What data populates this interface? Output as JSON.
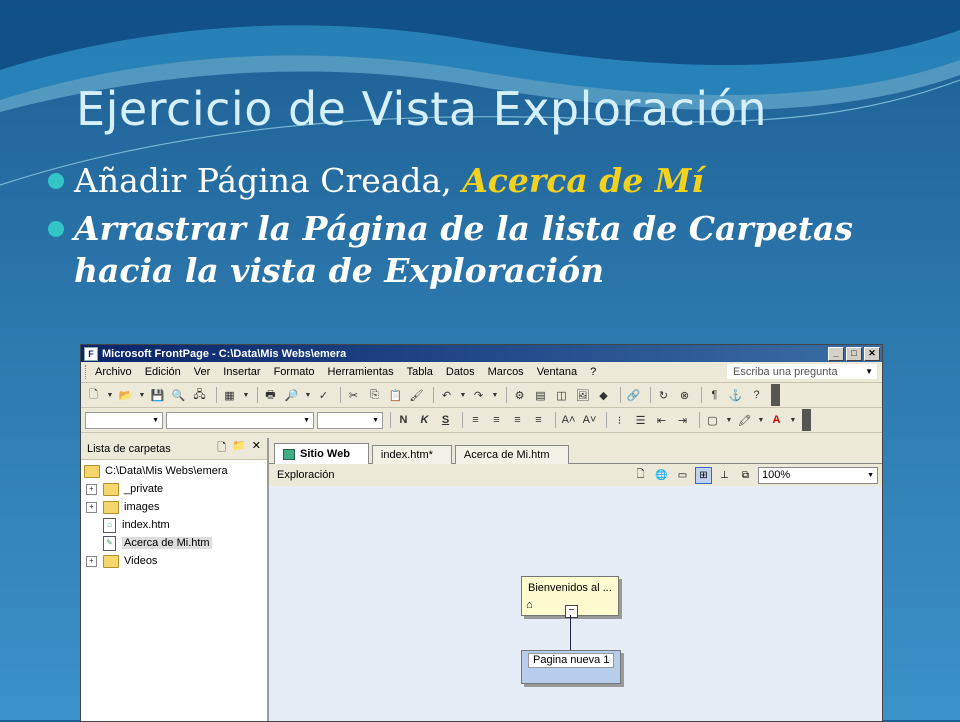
{
  "slide": {
    "title": "Ejercicio de Vista Exploración",
    "bullet1_prefix": "Añadir Página Creada, ",
    "bullet1_highlight": "Acerca de Mí",
    "bullet2": "Arrastrar la Página de la lista de Carpetas hacia la vista de Exploración",
    "colors": {
      "title": "#d6f0fb",
      "highlight": "#f2d21e",
      "bullet": "#33c6c6"
    }
  },
  "window": {
    "title": "Microsoft FrontPage - C:\\Data\\Mis Webs\\emera",
    "menu": [
      "Archivo",
      "Edición",
      "Ver",
      "Insertar",
      "Formato",
      "Herramientas",
      "Tabla",
      "Datos",
      "Marcos",
      "Ventana",
      "?"
    ],
    "ask_placeholder": "Escriba una pregunta"
  },
  "folder_list": {
    "header": "Lista de carpetas",
    "root": "C:\\Data\\Mis Webs\\emera",
    "items": [
      {
        "label": "_private",
        "type": "folder"
      },
      {
        "label": "images",
        "type": "folder"
      },
      {
        "label": "index.htm",
        "type": "page"
      },
      {
        "label": "Acerca de Mi.htm",
        "type": "page"
      },
      {
        "label": "Videos",
        "type": "folder"
      }
    ]
  },
  "tabs": [
    "Sitio Web",
    "index.htm*",
    "Acerca de Mi.htm"
  ],
  "view": {
    "label": "Exploración",
    "zoom": "100%"
  },
  "navigation": {
    "node_home": "Bienvenidos al ...",
    "node_child": "Pagina nueva 1"
  }
}
